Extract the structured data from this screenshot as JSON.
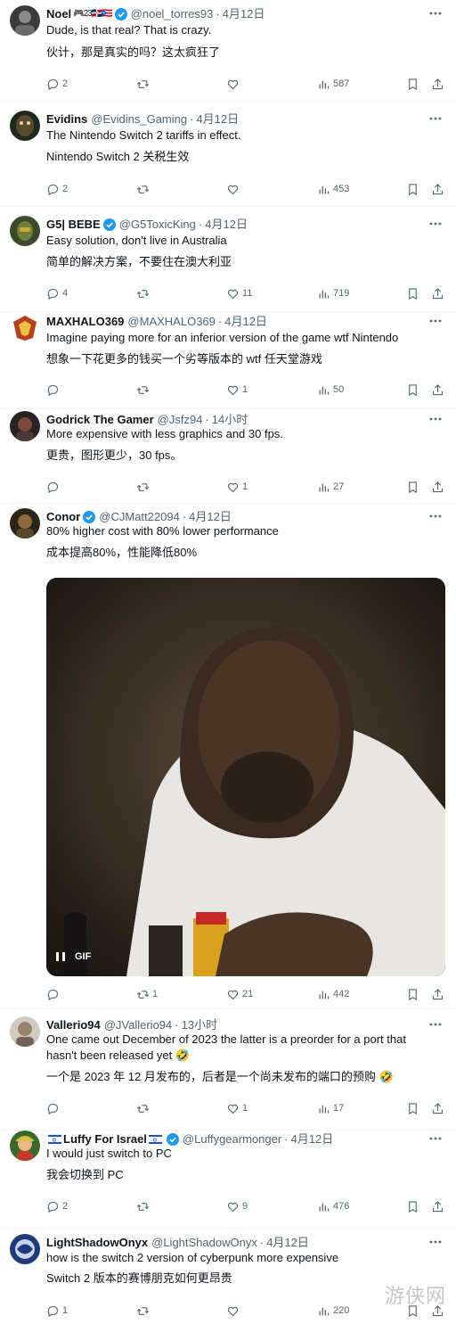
{
  "posts": [
    {
      "name": "Noel",
      "name_suffix": "🎮23🇩🇴🇵🇷",
      "handle": "@noel_torres93",
      "date": "4月12日",
      "verified": true,
      "lines": [
        "Dude, is that real? That is crazy.",
        "伙计，那是真实的吗？这太疯狂了"
      ],
      "replies": "2",
      "retweets": "",
      "likes": "",
      "views": "587"
    },
    {
      "name": "Evidins",
      "handle": "@Evidins_Gaming",
      "date": "4月12日",
      "verified": false,
      "lines": [
        "The Nintendo Switch 2 tariffs in effect.",
        "Nintendo Switch 2 关税生效"
      ],
      "replies": "2",
      "retweets": "",
      "likes": "",
      "views": "453"
    },
    {
      "name": "G5| BEBE",
      "handle": "@G5ToxicKing",
      "date": "4月12日",
      "verified": true,
      "lines": [
        "Easy solution, don't live in Australia",
        "简单的解决方案，不要住在澳大利亚"
      ],
      "replies": "4",
      "retweets": "",
      "likes": "11",
      "views": "719"
    },
    {
      "name": "MAXHALO369",
      "handle": "@MAXHALO369",
      "date": "4月12日",
      "verified": false,
      "lines": [
        "Imagine paying more for an inferior version of the game wtf Nintendo",
        "想象一下花更多的钱买一个劣等版本的 wtf 任天堂游戏"
      ],
      "replies": "",
      "retweets": "",
      "likes": "1",
      "views": "50"
    },
    {
      "name": "Godrick The Gamer",
      "handle": "@Jsfz94",
      "date": "14小时",
      "verified": false,
      "lines": [
        "More expensive with less graphics and 30 fps.",
        "更贵，图形更少，30 fps。"
      ],
      "replies": "",
      "retweets": "",
      "likes": "1",
      "views": "27"
    },
    {
      "name": "Conor",
      "handle": "@CJMatt22094",
      "date": "4月12日",
      "verified": true,
      "lines": [
        "80% higher cost with 80% lower performance",
        "成本提高80%，性能降低80%"
      ],
      "media_label": "GIF",
      "replies": "",
      "retweets": "1",
      "likes": "21",
      "views": "442"
    },
    {
      "name": "Vallerio94",
      "handle": "@JVallerio94",
      "date": "13小时",
      "verified": false,
      "lines": [
        "One came out December of 2023 the latter is a preorder for a port that",
        "hasn't been released yet 🤣",
        "一个是 2023 年 12 月发布的，后者是一个尚未发布的端口的预购 🤣"
      ],
      "replies": "",
      "retweets": "",
      "likes": "1",
      "views": "17"
    },
    {
      "name": "Luffy For Israel",
      "handle": "@Luffygearmonger",
      "date": "4月12日",
      "verified": true,
      "lines": [
        "I would just switch to PC",
        "我会切换到 PC"
      ],
      "replies": "2",
      "retweets": "",
      "likes": "9",
      "views": "476"
    },
    {
      "name": "LightShadowOnyx",
      "handle": "@LightShadowOnyx",
      "date": "4月12日",
      "verified": false,
      "lines": [
        "how is the switch 2 version of cyberpunk more expensive",
        "Switch 2 版本的赛博朋克如何更昂贵"
      ],
      "replies": "1",
      "retweets": "",
      "likes": "",
      "views": "220"
    }
  ],
  "icons": {
    "reply": "reply-icon",
    "retweet": "retweet-icon",
    "like": "heart-icon",
    "views": "views-icon",
    "bookmark": "bookmark-icon",
    "share": "share-icon",
    "more": "more-icon",
    "verified": "verified-badge-icon",
    "pause": "pause-icon"
  },
  "watermark": "游侠网",
  "colors": {
    "text": "#0f1419",
    "muted": "#536471",
    "verified": "#1d9bf0",
    "divider": "#eff3f4"
  }
}
